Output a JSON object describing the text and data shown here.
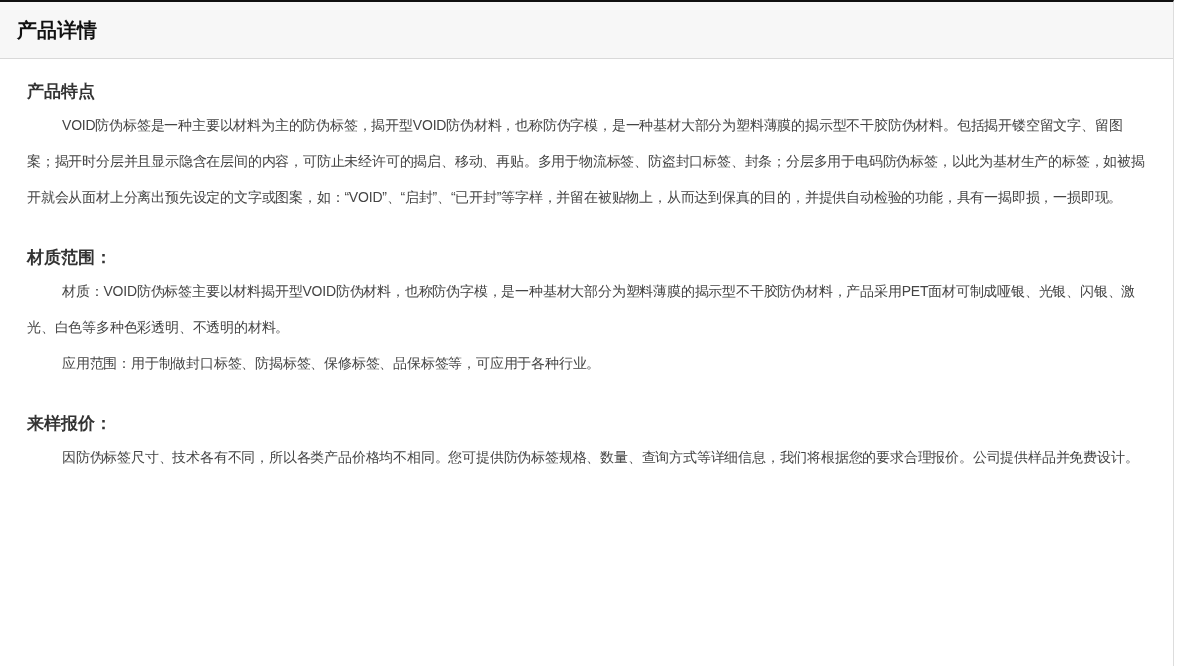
{
  "panel": {
    "title": "产品详情"
  },
  "sections": [
    {
      "heading": "产品特点",
      "paragraphs": [
        "VOID防伪标签是一种主要以材料为主的防伪标签，揭开型VOID防伪材料，也称防伪字模，是一种基材大部分为塑料薄膜的揭示型不干胶防伪材料。包括揭开镂空留文字、留图案；揭开时分层并且显示隐含在层间的内容，可防止未经许可的揭启、移动、再贴。多用于物流标签、防盗封口标签、封条；分层多用于电码防伪标签，以此为基材生产的标签，如被揭开就会从面材上分离出预先设定的文字或图案，如：“VOID”、“启封”、“已开封”等字样，并留在被贴物上，从而达到保真的目的，并提供自动检验的功能，具有一揭即损，一损即现。"
      ]
    },
    {
      "heading": "材质范围：",
      "paragraphs": [
        "材质：VOID防伪标签主要以材料揭开型VOID防伪材料，也称防伪字模，是一种基材大部分为塑料薄膜的揭示型不干胶防伪材料，产品采用PET面材可制成哑银、光银、闪银、激光、白色等多种色彩透明、不透明的材料。",
        "应用范围：用于制做封口标签、防揭标签、保修标签、品保标签等，可应用于各种行业。"
      ]
    },
    {
      "heading": "来样报价：",
      "paragraphs": [
        "因防伪标签尺寸、技术各有不同，所以各类产品价格均不相同。您可提供防伪标签规格、数量、查询方式等详细信息，我们将根据您的要求合理报价。公司提供样品并免费设计。"
      ]
    }
  ]
}
